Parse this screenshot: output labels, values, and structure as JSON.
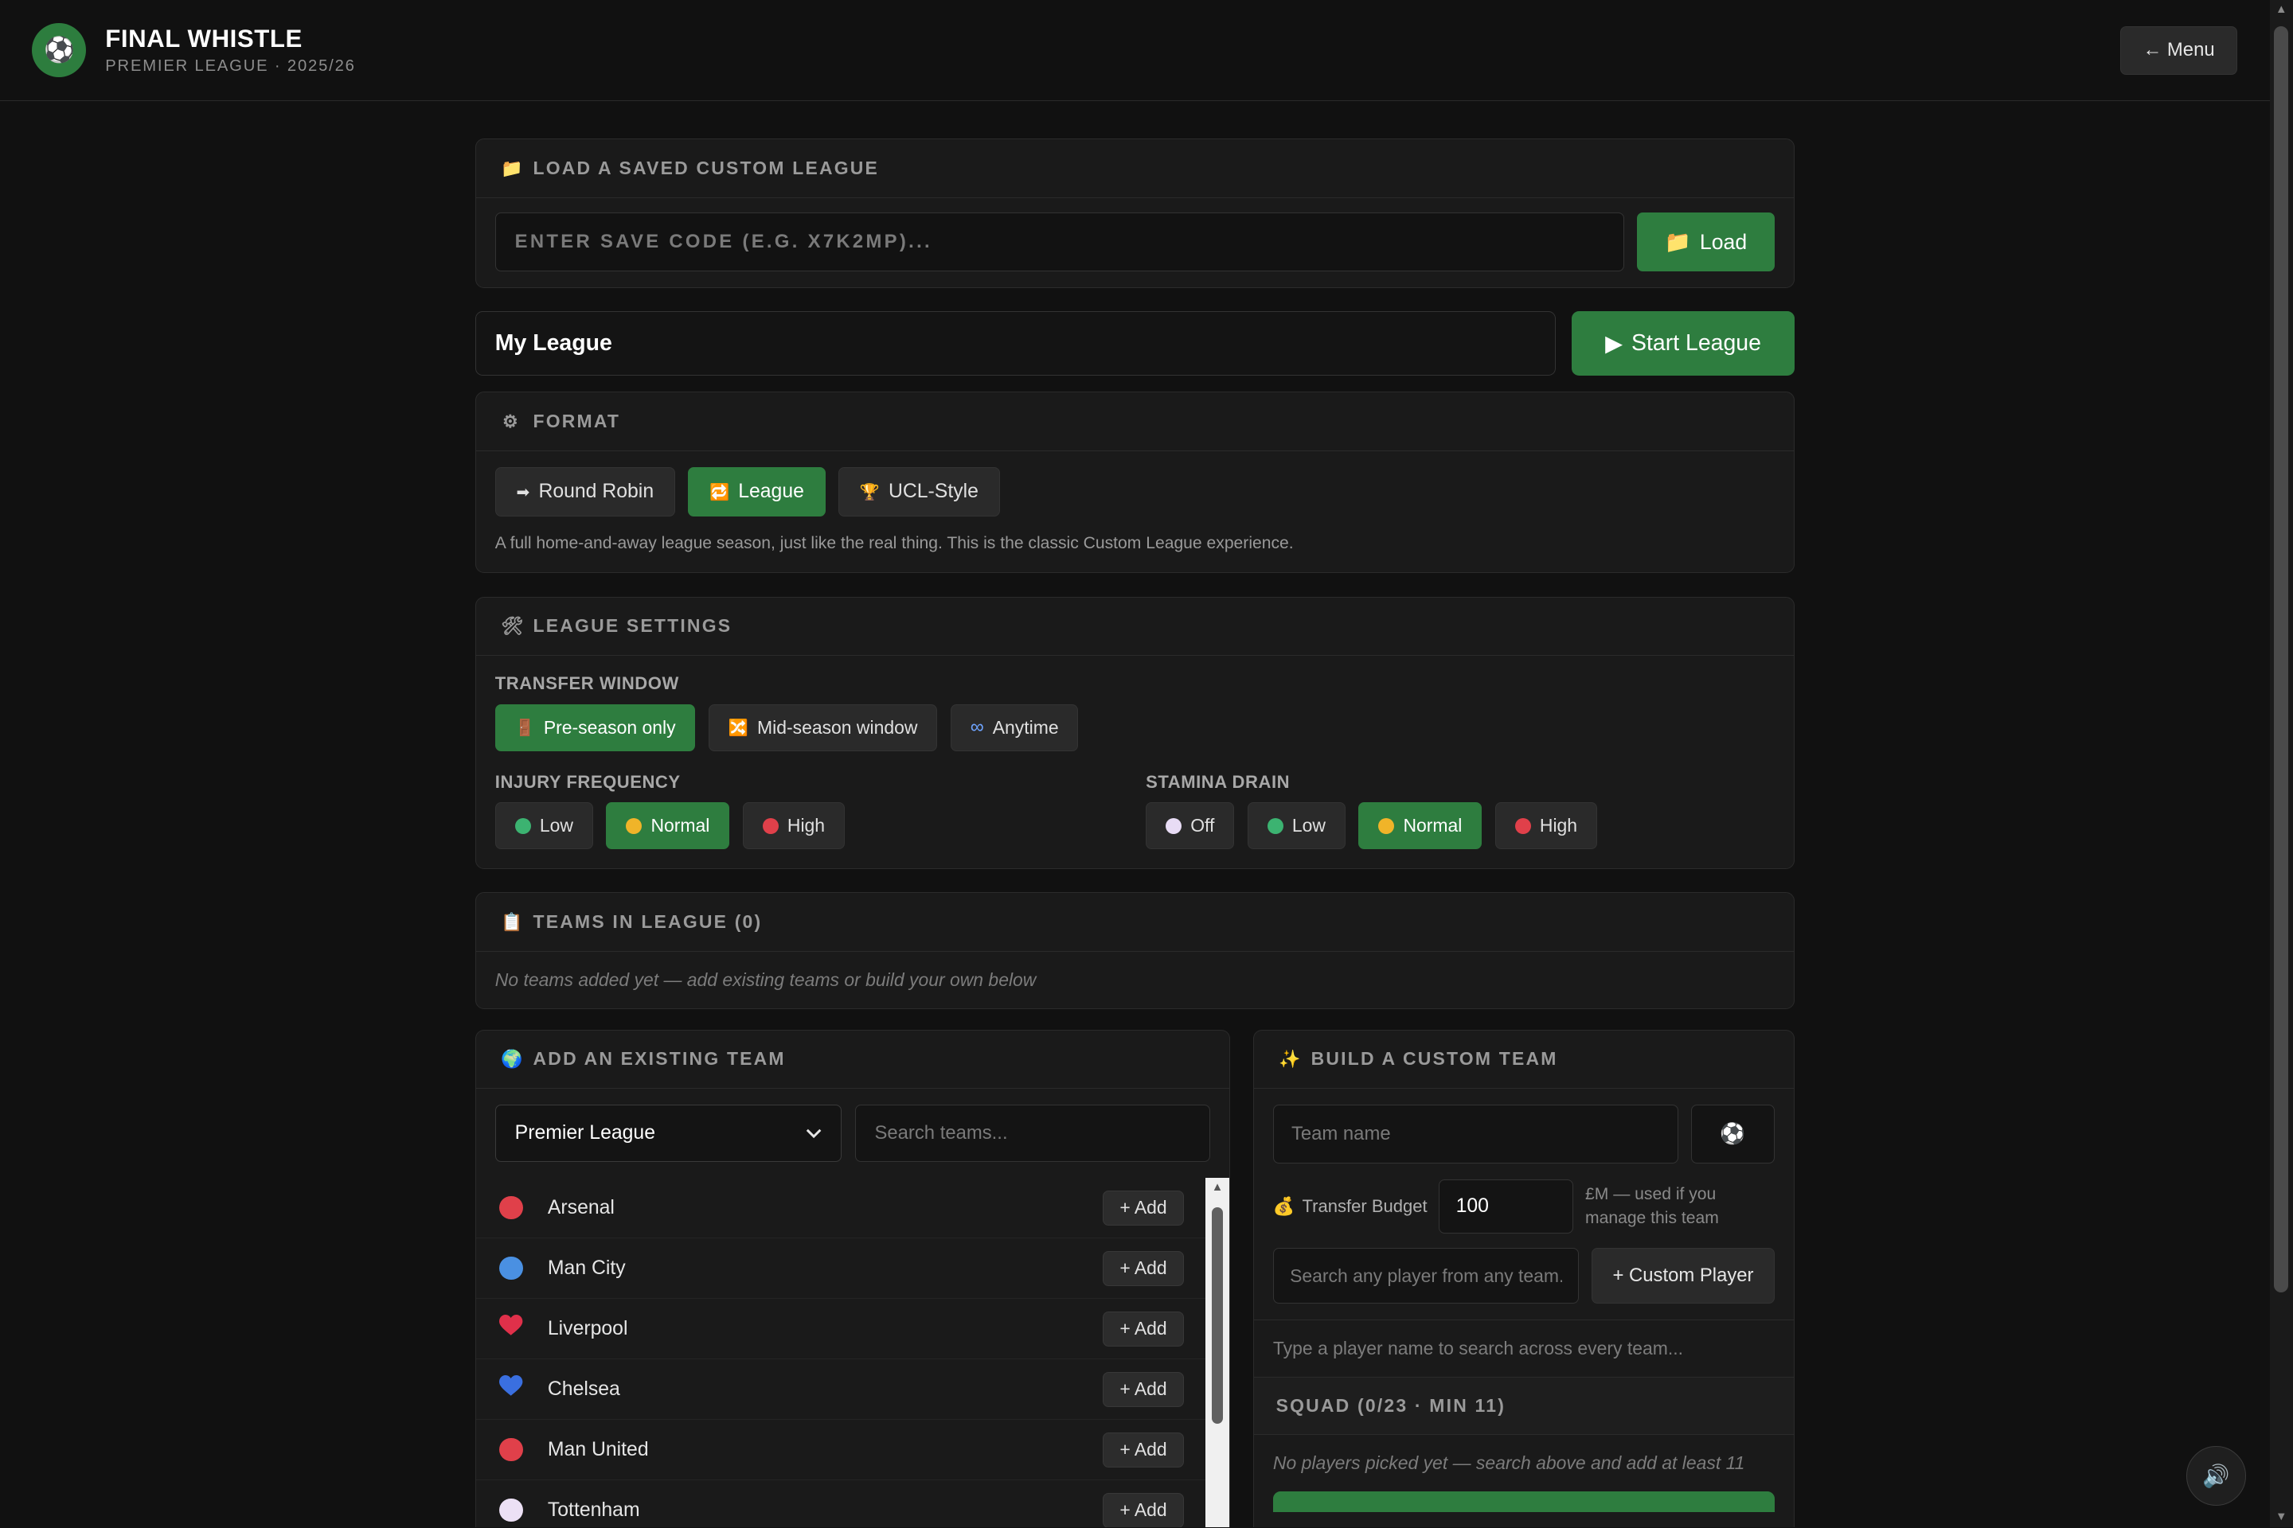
{
  "header": {
    "title": "FINAL WHISTLE",
    "subtitle": "PREMIER LEAGUE · 2025/26",
    "logo_glyph": "⚽",
    "menu_label": "← Menu"
  },
  "load_panel": {
    "title": "LOAD A SAVED CUSTOM LEAGUE",
    "icon": "📁",
    "code_placeholder": "ENTER SAVE CODE (E.G. X7K2MP)...",
    "load_label": "Load",
    "load_icon": "📁"
  },
  "league_name": {
    "value": "My League",
    "start_label": "Start League",
    "start_icon": "▶"
  },
  "format": {
    "title": "FORMAT",
    "icon": "⚙",
    "options": [
      {
        "label": "Round Robin",
        "icon": "➡",
        "active": false
      },
      {
        "label": "League",
        "icon": "🔁",
        "active": true
      },
      {
        "label": "UCL-Style",
        "icon": "🏆",
        "active": false
      }
    ],
    "description": "A full home-and-away league season, just like the real thing. This is the classic Custom League experience."
  },
  "settings": {
    "title": "LEAGUE SETTINGS",
    "icon": "🛠",
    "transfer_window": {
      "label": "TRANSFER WINDOW",
      "options": [
        {
          "label": "Pre-season only",
          "icon": "🚪",
          "active": true
        },
        {
          "label": "Mid-season window",
          "icon": "🔀",
          "active": false
        },
        {
          "label": "Anytime",
          "icon": "∞",
          "active": false
        }
      ]
    },
    "injury_frequency": {
      "label": "INJURY FREQUENCY",
      "options": [
        {
          "label": "Low",
          "color": "#3cb371",
          "active": false
        },
        {
          "label": "Normal",
          "color": "#f0b429",
          "active": true
        },
        {
          "label": "High",
          "color": "#e0404a",
          "active": false
        }
      ]
    },
    "stamina_drain": {
      "label": "STAMINA DRAIN",
      "options": [
        {
          "label": "Off",
          "color": "#e8dcf5",
          "active": false
        },
        {
          "label": "Low",
          "color": "#3cb371",
          "active": false
        },
        {
          "label": "Normal",
          "color": "#f0b429",
          "active": true
        },
        {
          "label": "High",
          "color": "#e0404a",
          "active": false
        }
      ]
    }
  },
  "teams_in_league": {
    "title": "TEAMS IN LEAGUE (0)",
    "icon": "📋",
    "empty": "No teams added yet — add existing teams or build your own below"
  },
  "existing": {
    "title": "ADD AN EXISTING TEAM",
    "icon": "🌍",
    "league_select": "Premier League",
    "search_placeholder": "Search teams...",
    "add_label": "+ Add",
    "teams": [
      {
        "name": "Arsenal",
        "color": "#e0404a"
      },
      {
        "name": "Man City",
        "color": "#4a90e2"
      },
      {
        "name": "Liverpool",
        "color": "#e0304a"
      },
      {
        "name": "Chelsea",
        "color": "#3a6fe0"
      },
      {
        "name": "Man United",
        "color": "#e0404a"
      },
      {
        "name": "Tottenham",
        "color": "#ece0f5"
      }
    ]
  },
  "custom": {
    "title": "BUILD A CUSTOM TEAM",
    "icon": "✨",
    "team_name_placeholder": "Team name",
    "globe_icon": "⚽",
    "budget_label": "Transfer Budget",
    "budget_icon": "💰",
    "budget_value": "100",
    "budget_note": "£M — used if you manage this team",
    "player_search_placeholder": "Search any player from any team...",
    "custom_player_label": "+ Custom Player",
    "hint": "Type a player name to search across every team...",
    "squad_title": "SQUAD (0/23 · MIN 11)",
    "squad_empty": "No players picked yet — search above and add at least 11"
  },
  "sound_icon": "🔊"
}
